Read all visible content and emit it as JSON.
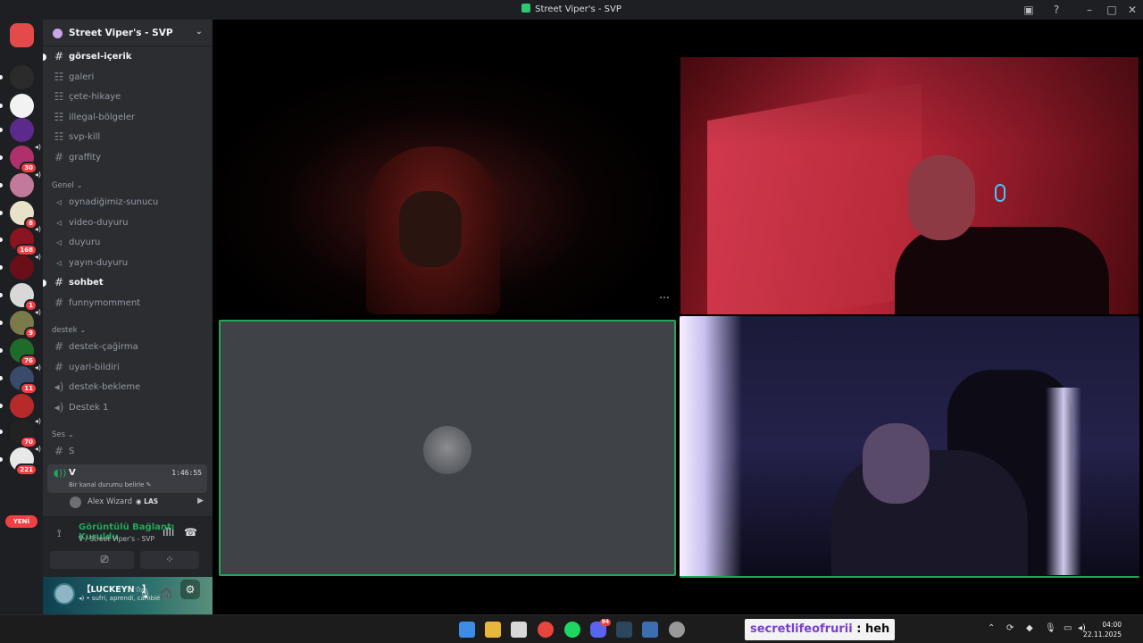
{
  "window": {
    "title": "Street Viper's - SVP",
    "icons": [
      "screen-share-icon",
      "help-icon",
      "minimize-icon",
      "maximize-icon",
      "close-icon"
    ]
  },
  "rail": {
    "servers": [
      {
        "name": "discord-home",
        "color": "#e34b4b"
      },
      {
        "name": "server-2",
        "color": "#2b2b2b"
      },
      {
        "name": "server-3",
        "color": "#f2f2f2"
      },
      {
        "name": "server-4",
        "color": "#5b2a8a"
      },
      {
        "name": "server-5",
        "color": "#b0306b",
        "badge": "30"
      },
      {
        "name": "server-6",
        "color": "#c27a9a"
      },
      {
        "name": "server-7",
        "color": "#e8e3c8",
        "badge": "8"
      },
      {
        "name": "server-8",
        "color": "#8a1520",
        "badge": "168"
      },
      {
        "name": "server-9",
        "color": "#6a0f18"
      },
      {
        "name": "server-10",
        "color": "#d8d8d8",
        "badge": "1"
      },
      {
        "name": "server-11",
        "color": "#7a7a4a",
        "badge": "9"
      },
      {
        "name": "server-12",
        "color": "#1f6b2a",
        "badge": "76"
      },
      {
        "name": "server-13",
        "color": "#3a4a6a",
        "badge": "11"
      },
      {
        "name": "server-14",
        "color": "#b82a2a"
      },
      {
        "name": "server-15",
        "color": "#222222",
        "badge": "70"
      },
      {
        "name": "server-16",
        "color": "#e8e8e8",
        "badge": "221"
      }
    ],
    "new_label": "YENİ"
  },
  "server": {
    "name": "Street Viper's - SVP"
  },
  "channels": [
    {
      "type": "text",
      "name": "görsel-içerik",
      "unread": true
    },
    {
      "type": "forum",
      "name": "galeri"
    },
    {
      "type": "forum",
      "name": "çete-hikaye"
    },
    {
      "type": "forum",
      "name": "illegal-bölgeler"
    },
    {
      "type": "forum",
      "name": "svp-kill"
    },
    {
      "type": "text",
      "name": "graffity"
    }
  ],
  "categories": {
    "genel": "Genel",
    "destek": "destek",
    "ses": "Ses"
  },
  "genel_channels": [
    {
      "type": "announce",
      "name": "oynadiğimiz-sunucu"
    },
    {
      "type": "announce",
      "name": "video-duyuru"
    },
    {
      "type": "announce",
      "name": "duyuru"
    },
    {
      "type": "announce",
      "name": "yayın-duyuru"
    },
    {
      "type": "text",
      "name": "sohbet",
      "unread": true
    },
    {
      "type": "text",
      "name": "funnymomment"
    }
  ],
  "destek_channels": [
    {
      "type": "text",
      "name": "destek-çağirma"
    },
    {
      "type": "text",
      "name": "uyari-bildiri"
    },
    {
      "type": "voice",
      "name": "destek-bekleme"
    },
    {
      "type": "voice",
      "name": "Destek 1"
    }
  ],
  "ses_channels": [
    {
      "type": "text",
      "name": "S"
    }
  ],
  "voice_channel": {
    "name": "V",
    "timer": "1:46:55",
    "status": "Bir kanal durumu belirle",
    "user": {
      "name": "Alex Wizard",
      "tag": "LAS"
    }
  },
  "connection": {
    "title": "Görüntülü Bağlantı Kuruldu",
    "subtitle": "V / Street Viper's - SVP"
  },
  "user": {
    "name": "【LUCKEYN☆】",
    "status": "sufri, aprendí, cambié"
  },
  "chat_overlay": {
    "user": "secretlifeofrurii",
    "separator": " : ",
    "message": "heh"
  },
  "taskbar": {
    "discord_badge": "94",
    "time": "04:00",
    "date": "22.11.2025"
  }
}
